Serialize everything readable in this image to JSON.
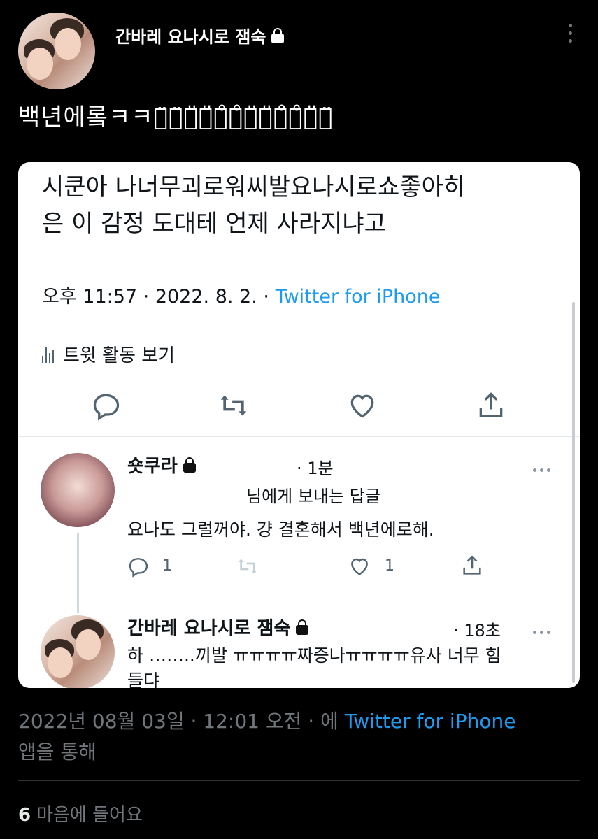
{
  "header": {
    "display_name": "간바레 요나시로 잼숙"
  },
  "tweet": {
    "text": "백년에롴ㅋㅋㅋ̈ㅋ̈ㅋ̎ㅋ̎ㅋ̊ㅋ̊ㅋ̎ㅋ̎ㅋ̊ㅋ̊ㅋ̎ㅋ̈"
  },
  "card": {
    "quote_line1": "시쿤아 나너무괴로워씨발요나시로쇼좋아히",
    "quote_line2": "은 이 감정 도대테 언제 사라지냐고",
    "meta_time": "오후 11:57 · 2022. 8. 2. · ",
    "meta_source": "Twitter for iPhone",
    "activity_label": "트윗 활동 보기",
    "reply1": {
      "name": "숏쿠라",
      "time": "· 1분",
      "replying_to": "님에게 보내는 답글",
      "body": "요나도 그럴꺼야. 걍 결혼해서 백년에로해.",
      "reply_count": "1",
      "like_count": "1"
    },
    "reply2": {
      "name": "간바레 요나시로 잼숙",
      "time": "· 18초",
      "body_line1": "하 ……..끼발 ㅠㅠㅠㅠ짜증나ㅠㅠㅠㅠ유사 너무 힘",
      "body_line2": "들댜"
    }
  },
  "footer": {
    "timestamp": "2022년 08월 03일 · 12:01 오전 · 에 ",
    "source": "Twitter for iPhone",
    "via": "앱을 통해",
    "like_count": "6",
    "like_label": "마음에 들어요"
  },
  "colors": {
    "background": "#000000",
    "link": "#1d9bf0",
    "muted": "#71767b"
  }
}
